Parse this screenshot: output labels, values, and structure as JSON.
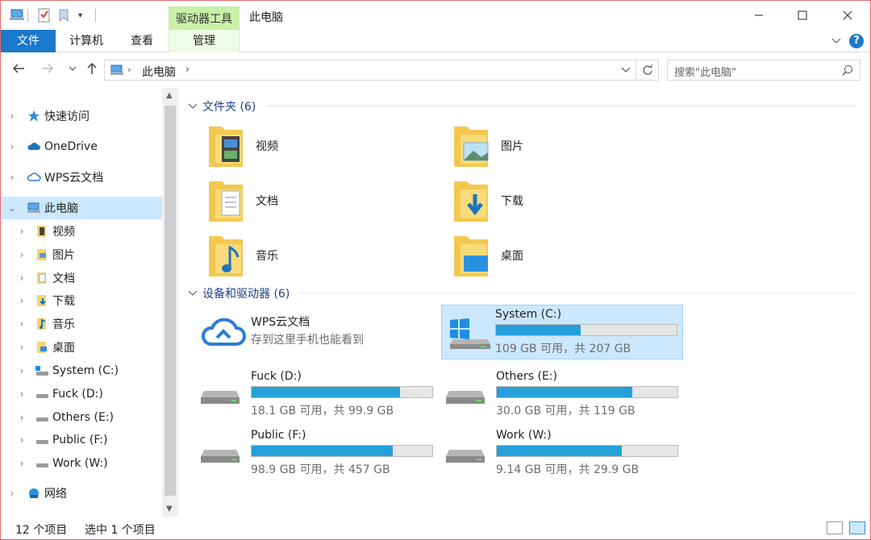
{
  "window": {
    "title": "此电脑",
    "context_tab": "驱动器工具",
    "controls": [
      "minimize",
      "maximize",
      "close"
    ]
  },
  "ribbon": {
    "tabs": [
      "文件",
      "计算机",
      "查看",
      "管理"
    ]
  },
  "address": {
    "path_root": "此电脑",
    "search_placeholder": "搜索\"此电脑\""
  },
  "nav": {
    "items": [
      {
        "label": "快速访问",
        "icon": "star-icon"
      },
      {
        "label": "OneDrive",
        "icon": "cloud-icon"
      },
      {
        "label": "WPS云文档",
        "icon": "wps-cloud-icon"
      },
      {
        "label": "此电脑",
        "icon": "computer-icon",
        "selected": true
      },
      {
        "label": "视频",
        "icon": "video-folder-icon"
      },
      {
        "label": "图片",
        "icon": "picture-folder-icon"
      },
      {
        "label": "文档",
        "icon": "document-folder-icon"
      },
      {
        "label": "下载",
        "icon": "download-folder-icon"
      },
      {
        "label": "音乐",
        "icon": "music-folder-icon"
      },
      {
        "label": "桌面",
        "icon": "desktop-folder-icon"
      },
      {
        "label": "System (C:)",
        "icon": "system-drive-icon"
      },
      {
        "label": "Fuck (D:)",
        "icon": "drive-icon"
      },
      {
        "label": "Others (E:)",
        "icon": "drive-icon"
      },
      {
        "label": "Public (F:)",
        "icon": "drive-icon"
      },
      {
        "label": "Work (W:)",
        "icon": "drive-icon"
      },
      {
        "label": "网络",
        "icon": "network-icon"
      }
    ]
  },
  "content": {
    "folders_header": "文件夹 (6)",
    "folders": [
      "视频",
      "图片",
      "文档",
      "下载",
      "音乐",
      "桌面"
    ],
    "drives_header": "设备和驱动器 (6)",
    "wps": {
      "name": "WPS云文档",
      "desc": "存到这里手机也能看到"
    },
    "drives": [
      {
        "name": "System (C:)",
        "info": "109 GB 可用，共 207 GB",
        "used_fraction": 0.47,
        "selected": true
      },
      {
        "name": "Fuck (D:)",
        "info": "18.1 GB 可用，共 99.9 GB",
        "used_fraction": 0.82
      },
      {
        "name": "Others (E:)",
        "info": "30.0 GB 可用，共 119 GB",
        "used_fraction": 0.75
      },
      {
        "name": "Public (F:)",
        "info": "98.9 GB 可用，共 457 GB",
        "used_fraction": 0.78
      },
      {
        "name": "Work (W:)",
        "info": "9.14 GB 可用，共 29.9 GB",
        "used_fraction": 0.69
      }
    ]
  },
  "status": {
    "count": "12 个项目",
    "selection": "选中 1 个项目"
  },
  "colors": {
    "accent": "#1979ca",
    "selection": "#cce8ff",
    "bar_fill": "#26a0da",
    "context_tab": "#c8f0a8"
  }
}
